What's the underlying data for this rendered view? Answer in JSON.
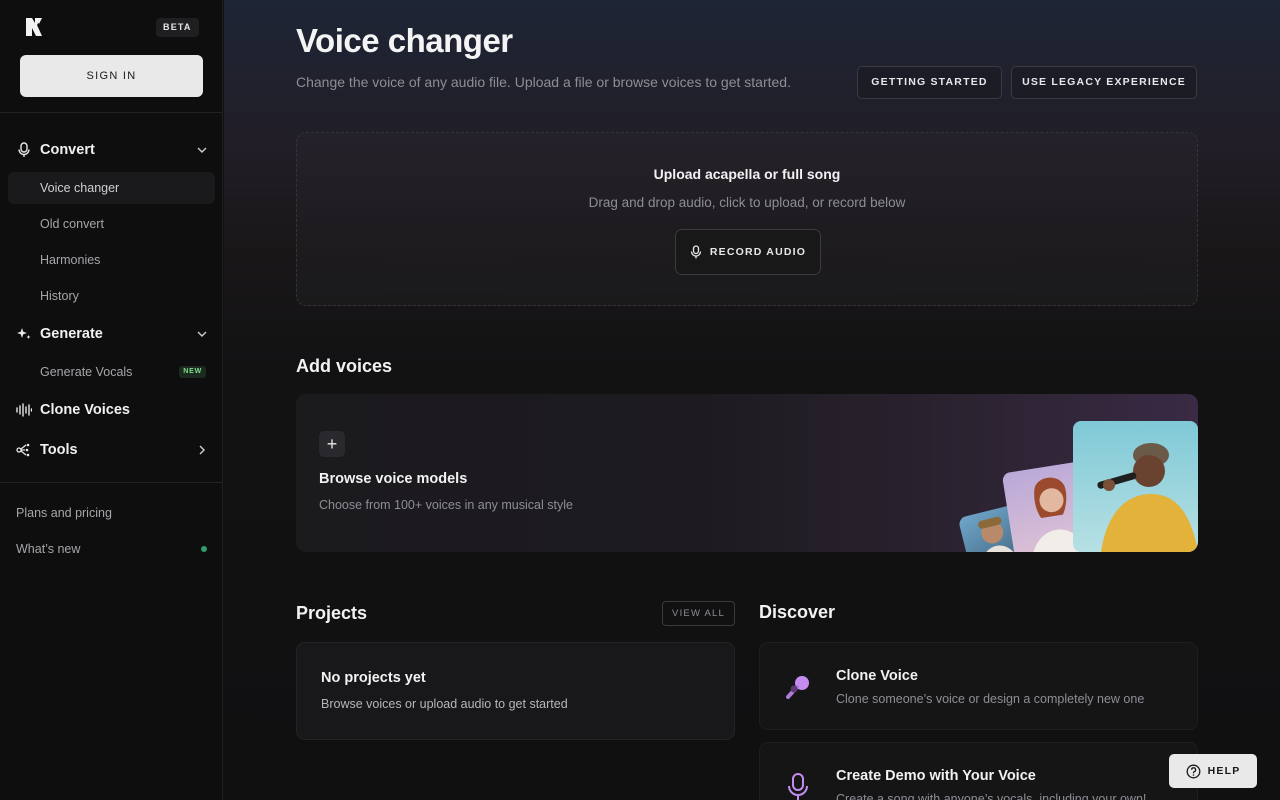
{
  "sidebar": {
    "beta": "BETA",
    "sign_in": "SIGN IN",
    "convert": {
      "label": "Convert",
      "items": [
        "Voice changer",
        "Old convert",
        "Harmonies",
        "History"
      ]
    },
    "generate": {
      "label": "Generate",
      "items": [
        "Generate Vocals"
      ],
      "new_badge": "NEW"
    },
    "clone_voices": "Clone Voices",
    "tools": "Tools",
    "plans": "Plans and pricing",
    "whats_new": "What’s new"
  },
  "header": {
    "title": "Voice changer",
    "subtitle": "Change the voice of any audio file. Upload a file or browse voices to get started.",
    "getting_started": "GETTING STARTED",
    "legacy": "USE LEGACY EXPERIENCE"
  },
  "upload": {
    "title": "Upload acapella or full song",
    "subtitle": "Drag and drop audio, click to upload, or record below",
    "record": "RECORD AUDIO"
  },
  "add_voices": {
    "heading": "Add voices",
    "card_title": "Browse voice models",
    "card_sub": "Choose from 100+ voices in any musical style"
  },
  "projects": {
    "heading": "Projects",
    "view_all": "VIEW ALL",
    "empty_title": "No projects yet",
    "empty_sub": "Browse voices or upload audio to get started"
  },
  "discover": {
    "heading": "Discover",
    "items": [
      {
        "title": "Clone Voice",
        "sub": "Clone someone’s voice or design a completely new one"
      },
      {
        "title": "Create Demo with Your Voice",
        "sub": "Create a song with anyone’s vocals, including your own!"
      }
    ]
  },
  "help": "HELP",
  "colors": {
    "accent_new": "#7ee08a",
    "status_dot": "#2f9e6a",
    "discover_icon": "#c58cf0"
  }
}
